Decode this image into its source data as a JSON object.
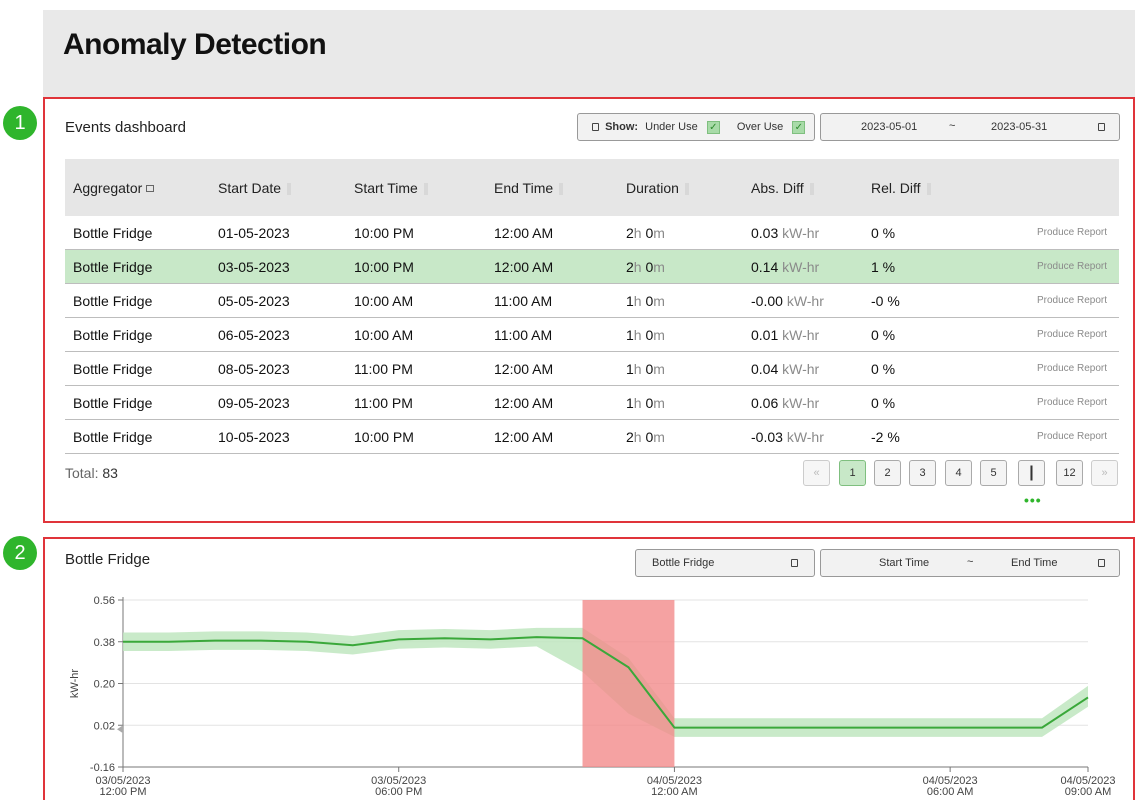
{
  "page": {
    "title": "Anomaly Detection"
  },
  "badges": {
    "one": "1",
    "two": "2"
  },
  "events": {
    "title": "Events dashboard",
    "show": {
      "label": "Show:",
      "under_use": "Under Use",
      "over_use": "Over Use",
      "under_checked": true,
      "over_checked": true
    },
    "date_range": {
      "start": "2023-05-01",
      "separator": "~",
      "end": "2023-05-31"
    },
    "columns": [
      "Aggregator",
      "Start Date",
      "Start Time",
      "End Time",
      "Duration",
      "Abs. Diff",
      "Rel. Diff"
    ],
    "rows": [
      {
        "aggregator": "Bottle Fridge",
        "start_date": "01-05-2023",
        "start_time": "10:00 PM",
        "end_time": "12:00 AM",
        "dur_h": "2",
        "dur_m": "0",
        "abs": "0.03",
        "rel": "0 %",
        "report": "Produce Report",
        "selected": false
      },
      {
        "aggregator": "Bottle Fridge",
        "start_date": "03-05-2023",
        "start_time": "10:00 PM",
        "end_time": "12:00 AM",
        "dur_h": "2",
        "dur_m": "0",
        "abs": "0.14",
        "rel": "1 %",
        "report": "Produce Report",
        "selected": true
      },
      {
        "aggregator": "Bottle Fridge",
        "start_date": "05-05-2023",
        "start_time": "10:00 AM",
        "end_time": "11:00 AM",
        "dur_h": "1",
        "dur_m": "0",
        "abs": "-0.00",
        "rel": "-0 %",
        "report": "Produce Report",
        "selected": false
      },
      {
        "aggregator": "Bottle Fridge",
        "start_date": "06-05-2023",
        "start_time": "10:00 AM",
        "end_time": "11:00 AM",
        "dur_h": "1",
        "dur_m": "0",
        "abs": "0.01",
        "rel": "0 %",
        "report": "Produce Report",
        "selected": false
      },
      {
        "aggregator": "Bottle Fridge",
        "start_date": "08-05-2023",
        "start_time": "11:00 PM",
        "end_time": "12:00 AM",
        "dur_h": "1",
        "dur_m": "0",
        "abs": "0.04",
        "rel": "0 %",
        "report": "Produce Report",
        "selected": false
      },
      {
        "aggregator": "Bottle Fridge",
        "start_date": "09-05-2023",
        "start_time": "11:00 PM",
        "end_time": "12:00 AM",
        "dur_h": "1",
        "dur_m": "0",
        "abs": "0.06",
        "rel": "0 %",
        "report": "Produce Report",
        "selected": false
      },
      {
        "aggregator": "Bottle Fridge",
        "start_date": "10-05-2023",
        "start_time": "10:00 PM",
        "end_time": "12:00 AM",
        "dur_h": "2",
        "dur_m": "0",
        "abs": "-0.03",
        "rel": "-2 %",
        "report": "Produce Report",
        "selected": false
      }
    ],
    "units": {
      "hours": "h",
      "minutes": "m",
      "energy": "kW-hr"
    },
    "total_label": "Total:",
    "total": "83",
    "pagination": {
      "prev": "«",
      "pages": [
        "1",
        "2",
        "3",
        "4",
        "5",
        "|",
        "12"
      ],
      "current": "1",
      "next": "»",
      "more": "•••"
    }
  },
  "detail": {
    "title": "Bottle Fridge",
    "aggregator_select": "Bottle Fridge",
    "time_range": {
      "start": "Start Time",
      "separator": "~",
      "end": "End Time"
    }
  },
  "colors": {
    "accent": "#2fb52c",
    "line": "#3aa83a",
    "band": "#bfe6bf",
    "anomaly": "#f28b8b",
    "border": "#e0343a"
  },
  "chart_data": {
    "type": "line",
    "ylabel": "kW-hr",
    "yticks": [
      "0.56",
      "0.38",
      "0.20",
      "0.02",
      "-0.16"
    ],
    "ylim": [
      -0.16,
      0.56
    ],
    "xticks": [
      {
        "date": "03/05/2023",
        "time": "12:00 PM",
        "hours": 0
      },
      {
        "date": "03/05/2023",
        "time": "06:00 PM",
        "hours": 6
      },
      {
        "date": "04/05/2023",
        "time": "12:00 AM",
        "hours": 12
      },
      {
        "date": "04/05/2023",
        "time": "06:00 AM",
        "hours": 18
      },
      {
        "date": "04/05/2023",
        "time": "09:00 AM",
        "hours": 21
      }
    ],
    "xlim": [
      0,
      21
    ],
    "series": [
      {
        "x": [
          0,
          1,
          2,
          3,
          4,
          5,
          6,
          7,
          8,
          9,
          10,
          11,
          12,
          13,
          14,
          15,
          16,
          17,
          18,
          19,
          20,
          21
        ],
        "values": [
          0.38,
          0.38,
          0.385,
          0.385,
          0.38,
          0.365,
          0.39,
          0.395,
          0.39,
          0.4,
          0.395,
          0.27,
          0.01,
          0.01,
          0.01,
          0.01,
          0.01,
          0.01,
          0.01,
          0.01,
          0.01,
          0.14
        ],
        "lower": [
          0.34,
          0.34,
          0.345,
          0.345,
          0.34,
          0.325,
          0.35,
          0.355,
          0.35,
          0.36,
          0.25,
          0.07,
          -0.03,
          -0.03,
          -0.03,
          -0.03,
          -0.03,
          -0.03,
          -0.03,
          -0.03,
          -0.03,
          0.1
        ],
        "upper": [
          0.42,
          0.42,
          0.425,
          0.425,
          0.42,
          0.405,
          0.43,
          0.435,
          0.43,
          0.44,
          0.44,
          0.31,
          0.05,
          0.05,
          0.05,
          0.05,
          0.05,
          0.05,
          0.05,
          0.05,
          0.05,
          0.19
        ]
      }
    ],
    "anomaly": {
      "x_start": 10,
      "x_end": 12
    },
    "grid": true
  }
}
